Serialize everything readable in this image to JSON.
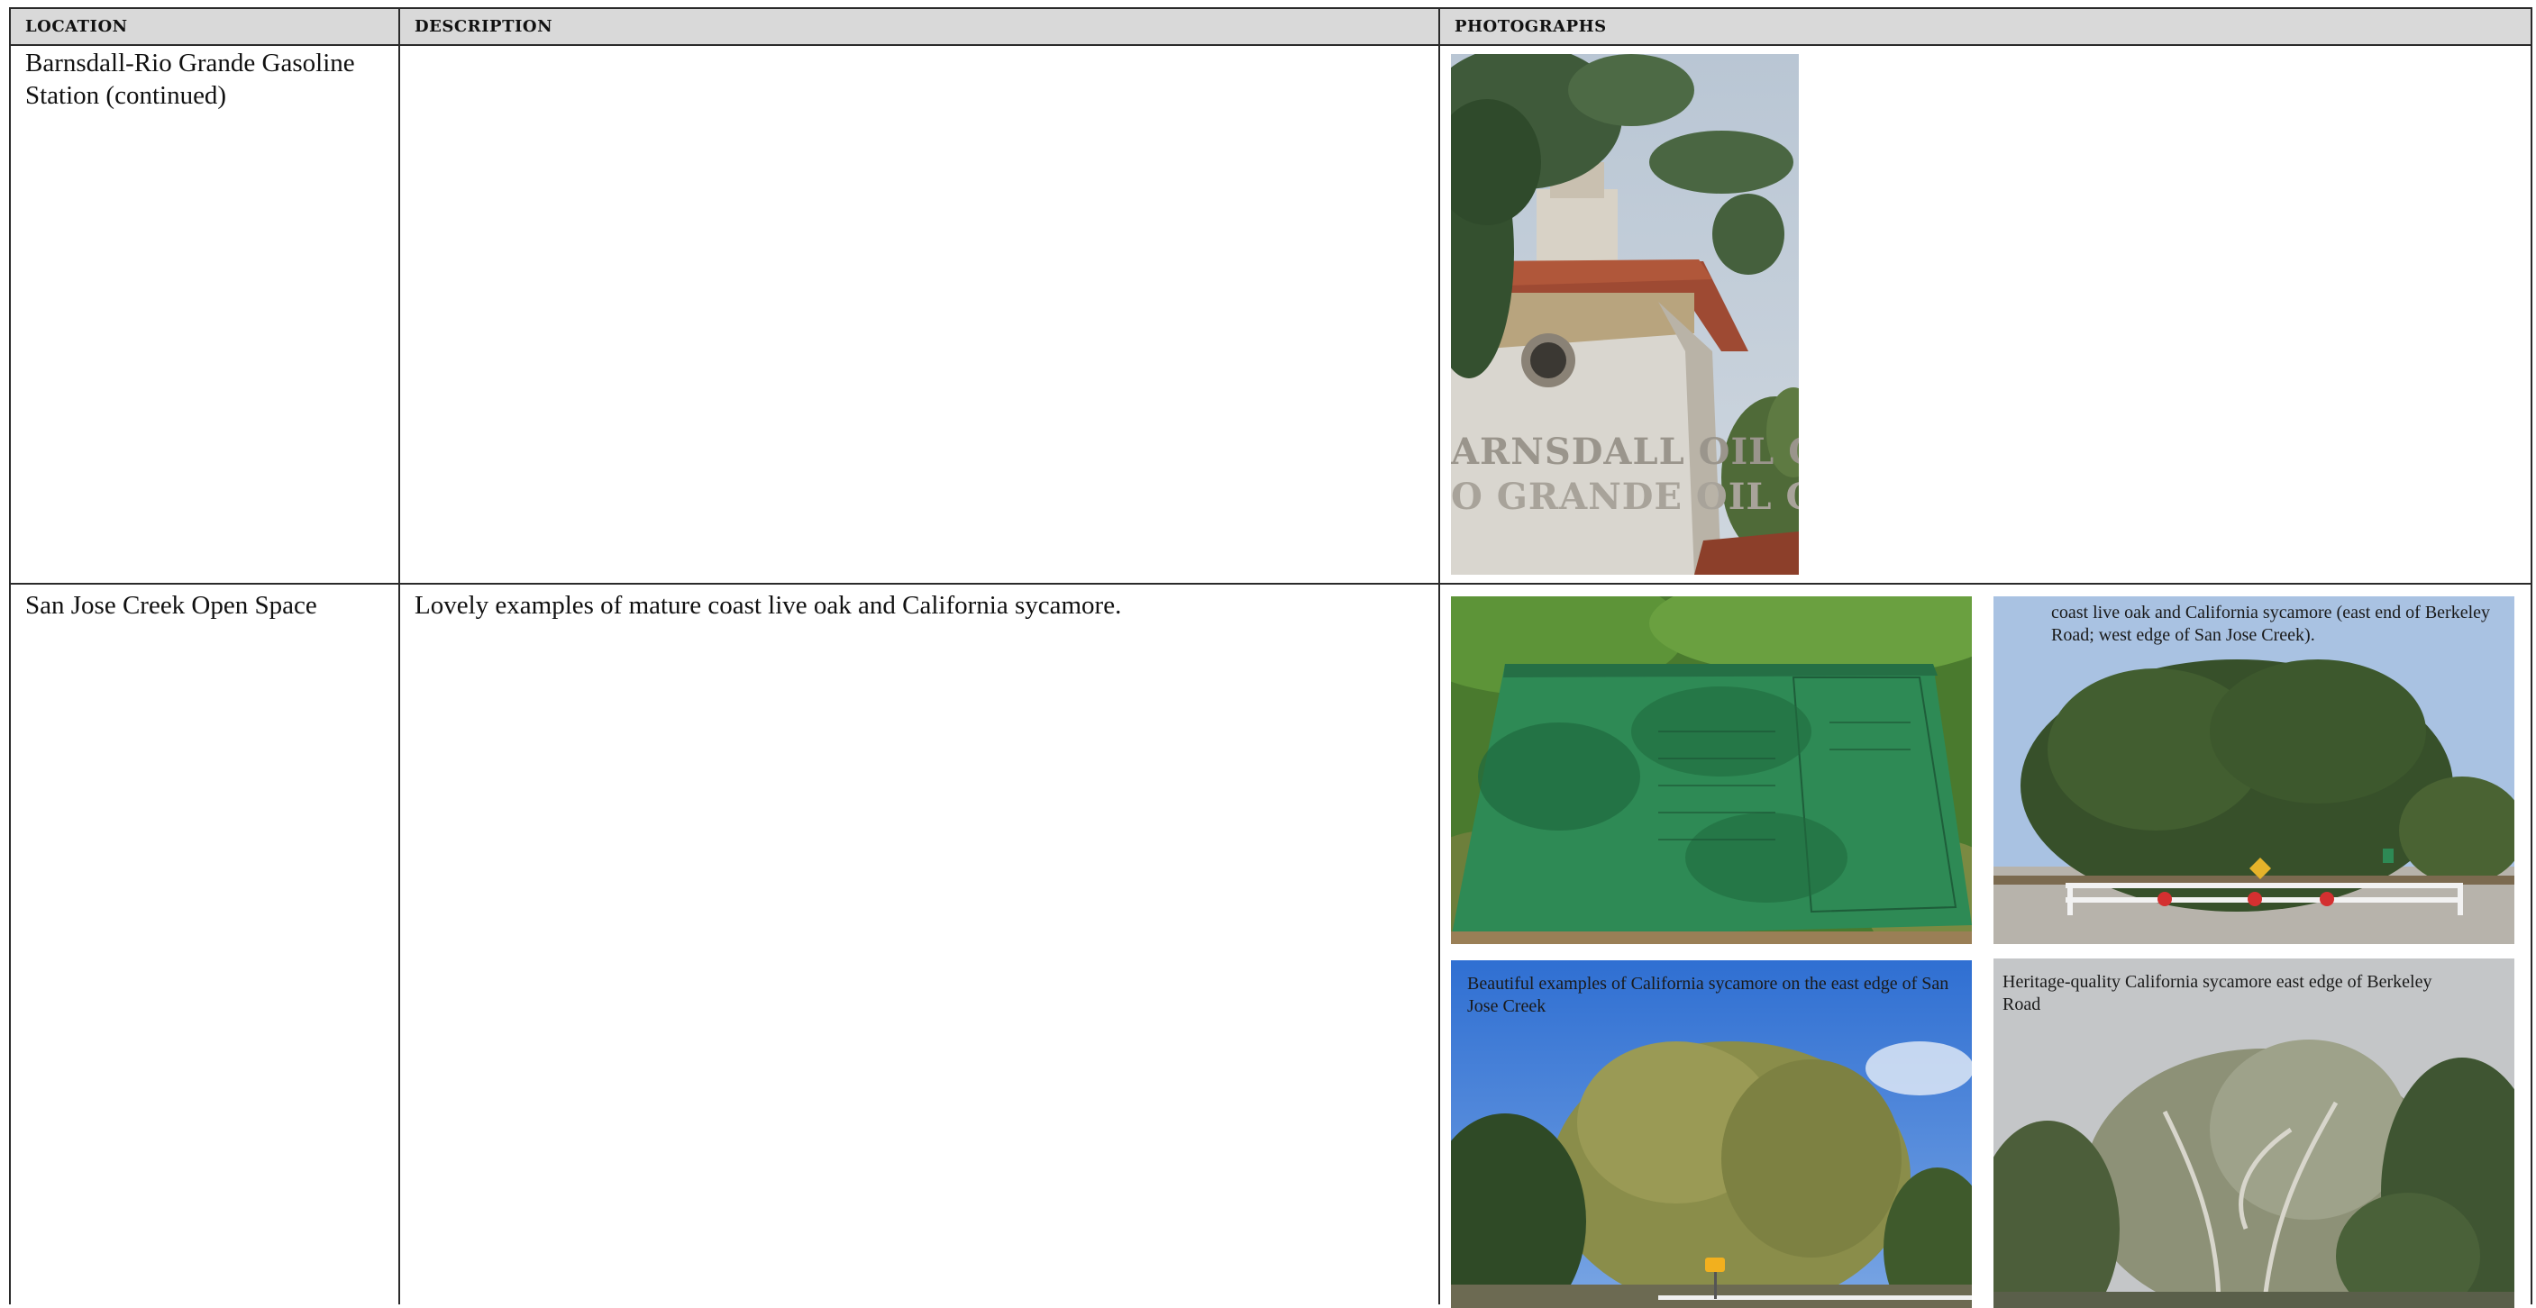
{
  "headers": {
    "location": "LOCATION",
    "description": "DESCRIPTION",
    "photographs": "PHOTOGRAPHS"
  },
  "rows": [
    {
      "location": "Barnsdall-Rio Grande Gasoline Station (continued)",
      "description": "",
      "photos": [
        {
          "subject": "gas-station-tower-photo",
          "sign_text": "BARNSDALL OIL CO. RIO GRANDE OIL CO."
        }
      ]
    },
    {
      "location": "San Jose Creek Open Space",
      "description": "Lovely examples of mature coast live oak and California sycamore.",
      "photos": [
        {
          "subject": "interpretive-sign-photo",
          "caption": ""
        },
        {
          "subject": "oak-tree-road-photo",
          "caption": "coast live oak and California sycamore (east end of Berkeley Road; west edge of San Jose Creek)."
        },
        {
          "subject": "sycamore-creek-photo",
          "caption": "Beautiful examples of California sycamore on the east edge of San Jose Creek"
        },
        {
          "subject": "heritage-sycamore-photo",
          "caption": "Heritage-quality California sycamore east edge of Berkeley Road"
        }
      ]
    }
  ]
}
